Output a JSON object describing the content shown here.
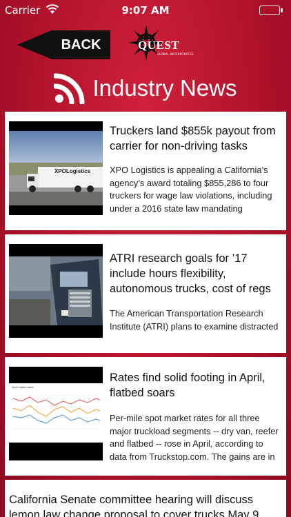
{
  "status_bar": {
    "carrier": "Carrier",
    "time": "9:07 AM",
    "battery": 1.0
  },
  "header": {
    "back_label": "BACK",
    "logo_text": "QUEST",
    "logo_subtext": "GLOBAL INCORPORATED",
    "title": "Industry News",
    "title_icon": "rss-icon"
  },
  "articles": [
    {
      "headline": "Truckers land $855k payout from carrier for non-driving tasks",
      "summary": "XPO Logistics is appealing a California’s agency’s award totaling $855,286 to four truckers for wage law violations, including under a 2016 state law mandating",
      "image_text": "XPOLogistics"
    },
    {
      "headline": "ATRI research goals for ’17 include hours flexibility, autonomous trucks, cost of regs",
      "summary": "The American Transportation Research Institute (ATRI) plans to examine distracted"
    },
    {
      "headline": "Rates find solid footing in April, flatbed soars",
      "summary": "Per-mile spot market rates for all three major truckload segments -- dry van, reefer and flatbed -- rose in April, according to data from Truckstop.com. The gains are in",
      "image_text": "Spot market rates"
    },
    {
      "headline": "California Senate committee hearing will discuss lemon law change proposal to cover trucks May 9"
    }
  ]
}
